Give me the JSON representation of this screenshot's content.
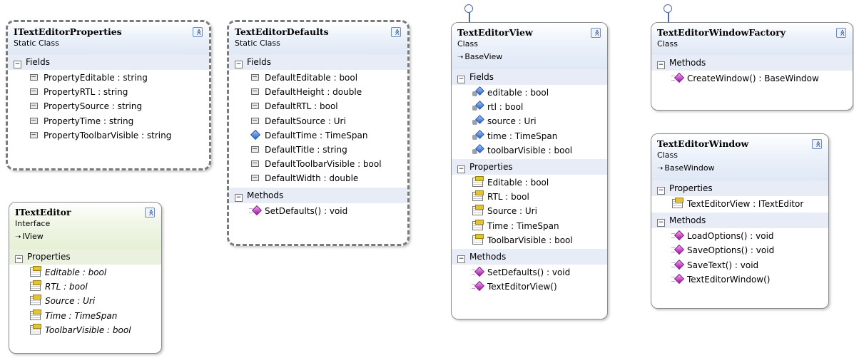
{
  "collapse_glyph": "≪",
  "classes": {
    "props": {
      "title": "ITextEditorProperties",
      "kind": "Static Class",
      "sections": [
        {
          "label": "Fields",
          "items": [
            {
              "text": "PropertyEditable : string",
              "icon": "constant-field-icon"
            },
            {
              "text": "PropertyRTL : string",
              "icon": "constant-field-icon"
            },
            {
              "text": "PropertySource : string",
              "icon": "constant-field-icon"
            },
            {
              "text": "PropertyTime : string",
              "icon": "constant-field-icon"
            },
            {
              "text": "PropertyToolbarVisible : string",
              "icon": "constant-field-icon"
            }
          ]
        }
      ]
    },
    "defaults": {
      "title": "TextEditorDefaults",
      "kind": "Static Class",
      "sections": [
        {
          "label": "Fields",
          "items": [
            {
              "text": "DefaultEditable : bool",
              "icon": "constant-field-icon"
            },
            {
              "text": "DefaultHeight : double",
              "icon": "constant-field-icon"
            },
            {
              "text": "DefaultRTL : bool",
              "icon": "constant-field-icon"
            },
            {
              "text": "DefaultSource : Uri",
              "icon": "constant-field-icon"
            },
            {
              "text": "DefaultTime : TimeSpan",
              "icon": "field-icon"
            },
            {
              "text": "DefaultTitle : string",
              "icon": "constant-field-icon"
            },
            {
              "text": "DefaultToolbarVisible : bool",
              "icon": "constant-field-icon"
            },
            {
              "text": "DefaultWidth : double",
              "icon": "constant-field-icon"
            }
          ]
        },
        {
          "label": "Methods",
          "items": [
            {
              "text": "SetDefaults() : void",
              "icon": "method-icon"
            }
          ]
        }
      ]
    },
    "ieditor": {
      "title": "ITextEditor",
      "kind": "Interface",
      "base": "IView",
      "sections": [
        {
          "label": "Properties",
          "items": [
            {
              "text": "Editable : bool",
              "icon": "property-icon"
            },
            {
              "text": "RTL : bool",
              "icon": "property-icon"
            },
            {
              "text": "Source : Uri",
              "icon": "property-icon"
            },
            {
              "text": "Time : TimeSpan",
              "icon": "property-icon"
            },
            {
              "text": "ToolbarVisible : bool",
              "icon": "property-icon"
            }
          ]
        }
      ]
    },
    "view": {
      "title": "TextEditorView",
      "kind": "Class",
      "base": "BaseView",
      "sections": [
        {
          "label": "Fields",
          "items": [
            {
              "text": "editable : bool",
              "icon": "private-field-icon"
            },
            {
              "text": "rtl : bool",
              "icon": "private-field-icon"
            },
            {
              "text": "source : Uri",
              "icon": "private-field-icon"
            },
            {
              "text": "time : TimeSpan",
              "icon": "private-field-icon"
            },
            {
              "text": "toolbarVisible : bool",
              "icon": "private-field-icon"
            }
          ]
        },
        {
          "label": "Properties",
          "items": [
            {
              "text": "Editable : bool",
              "icon": "property-icon"
            },
            {
              "text": "RTL : bool",
              "icon": "property-icon"
            },
            {
              "text": "Source : Uri",
              "icon": "property-icon"
            },
            {
              "text": "Time : TimeSpan",
              "icon": "property-icon"
            },
            {
              "text": "ToolbarVisible : bool",
              "icon": "property-icon"
            }
          ]
        },
        {
          "label": "Methods",
          "items": [
            {
              "text": "SetDefaults() : void",
              "icon": "method-icon"
            },
            {
              "text": "TextEditorView()",
              "icon": "method-icon"
            }
          ]
        }
      ]
    },
    "factory": {
      "title": "TextEditorWindowFactory",
      "kind": "Class",
      "sections": [
        {
          "label": "Methods",
          "items": [
            {
              "text": "CreateWindow() : BaseWindow",
              "icon": "method-icon"
            }
          ]
        }
      ]
    },
    "window": {
      "title": "TextEditorWindow",
      "kind": "Class",
      "base": "BaseWindow",
      "sections": [
        {
          "label": "Properties",
          "items": [
            {
              "text": "TextEditorView : ITextEditor",
              "icon": "property-icon"
            }
          ]
        },
        {
          "label": "Methods",
          "items": [
            {
              "text": "LoadOptions() : void",
              "icon": "method-icon"
            },
            {
              "text": "SaveOptions() : void",
              "icon": "method-icon"
            },
            {
              "text": "SaveText() : void",
              "icon": "method-icon"
            },
            {
              "text": "TextEditorWindow()",
              "icon": "method-icon"
            }
          ]
        }
      ]
    }
  }
}
